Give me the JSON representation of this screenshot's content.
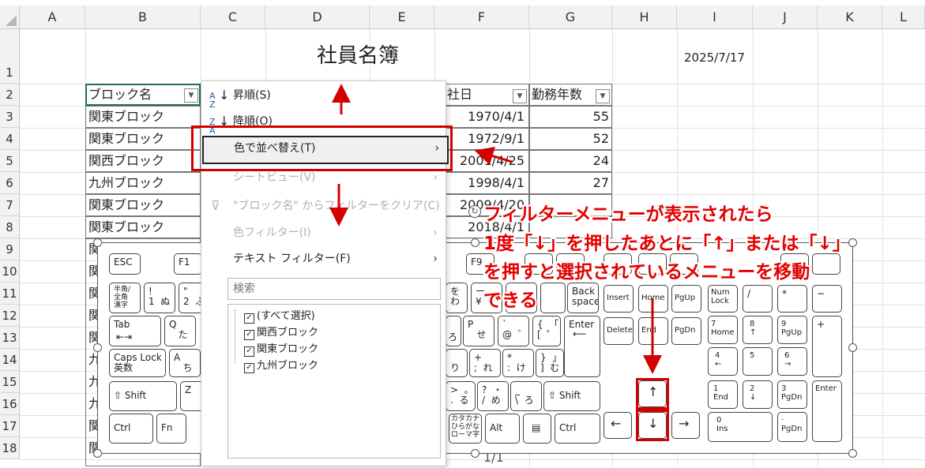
{
  "columns": [
    "A",
    "B",
    "C",
    "D",
    "E",
    "F",
    "G",
    "H",
    "I",
    "J",
    "K",
    "L"
  ],
  "rows": [
    "1",
    "2",
    "3",
    "4",
    "5",
    "6",
    "7",
    "8",
    "9",
    "10",
    "11",
    "12",
    "13",
    "14",
    "15",
    "16",
    "17",
    "18"
  ],
  "sheet": {
    "title": "社員名簿",
    "date": "2025/7/17",
    "headers": {
      "block": "ブロック名",
      "joined": "社日",
      "years": "勤務年数"
    },
    "block_col": [
      "関東ブロック",
      "関東ブロック",
      "関西ブロック",
      "九州ブロック",
      "関東ブロック",
      "関東ブロック"
    ],
    "block_stubs": [
      "関",
      "関",
      "関",
      "関",
      "関",
      "九",
      "九",
      "九",
      "関",
      "関"
    ],
    "joined_col": [
      "1970/4/1",
      "1972/9/1",
      "2001/4/25",
      "1998/4/1",
      "2009/4/20",
      "2018/4/1"
    ],
    "years_col": [
      "55",
      "52",
      "24",
      "27",
      "",
      ""
    ],
    "row18_tail": "1/1"
  },
  "menu": {
    "sort_asc": "昇順(S)",
    "sort_desc": "降順(O)",
    "sort_color": "色で並べ替え(T)",
    "sheet_view": "シートビュー(V)",
    "clear_filter": "\"ブロック名\" からフィルターをクリア(C)",
    "color_filter": "色フィルター(I)",
    "text_filter": "テキスト フィルター(F)",
    "search_placeholder": "検索",
    "list": [
      "(すべて選択)",
      "関西ブロック",
      "関東ブロック",
      "九州ブロック"
    ]
  },
  "annotation": {
    "line1": "フィルターメニューが表示されたら",
    "line2": "1度「↓」を押したあとに「↑」または「↓」",
    "line3": "を押すと選択されているメニューを移動",
    "line4": "できる"
  },
  "keyboard": {
    "esc": "ESC",
    "f1": "F1",
    "f9": "F9",
    "hankaku": "半角/\n全角\n漢字",
    "excl": "!\n1  ぬ",
    "dq": "\"\n2  ふ",
    "tab": "Tab",
    "q": "Q\n   た",
    "caps": "Caps Lock\n英数",
    "a": "A\n   ち",
    "shift_l": "⇧ Shift",
    "z": "Z",
    "ctrl_l": "Ctrl",
    "fn": "Fn",
    "wo": "を\nわ",
    "ro": "ー\n¥",
    "backspace": "Back\nspace",
    "p": "P\n   せ",
    "at": "`\n@  ゛",
    "lbr": "{  「\n[  ゜",
    "enter": "Enter",
    "semi": "+\n;  れ",
    "colon": "*\n:  け",
    "rbr": "}  」\n]  む",
    "ri": "\nり",
    "gt": ">  。\n.  る",
    "q2": "?  ・\n/  め",
    "bs2": "_\n\\  ろ",
    "shift_r": "⇧ Shift",
    "kata": "カタカナ\nひらがな\nローマ字",
    "alt": "Alt",
    "menu": "▤",
    "ctrl_r": "Ctrl",
    "insert": "Insert",
    "home": "Home",
    "pgup": "PgUp",
    "delete": "Delete",
    "end": "End",
    "pgdn": "PgDn",
    "numlock": "Num\nLock",
    "slash": "/",
    "star": "*",
    "minus": "−",
    "n7": "7\nHome",
    "n8": "8\n↑",
    "n9": "9\nPgUp",
    "plus": "+",
    "n4": "4\n←",
    "n5": "5",
    "n6": "6\n→",
    "n1": "1\nEnd",
    "n2": "2\n↓",
    "n3": "3\nPgDn",
    "nenter": "Enter",
    "n0": "0\nIns",
    "ndot": "·\nPgDn",
    "up": "↑",
    "down": "↓",
    "left": "←",
    "right": "→",
    "ro2": "ろ"
  },
  "colors": {
    "accent_red": "#d40000",
    "grid": "#e1e1e1",
    "header_bg": "#f2f2f2"
  }
}
